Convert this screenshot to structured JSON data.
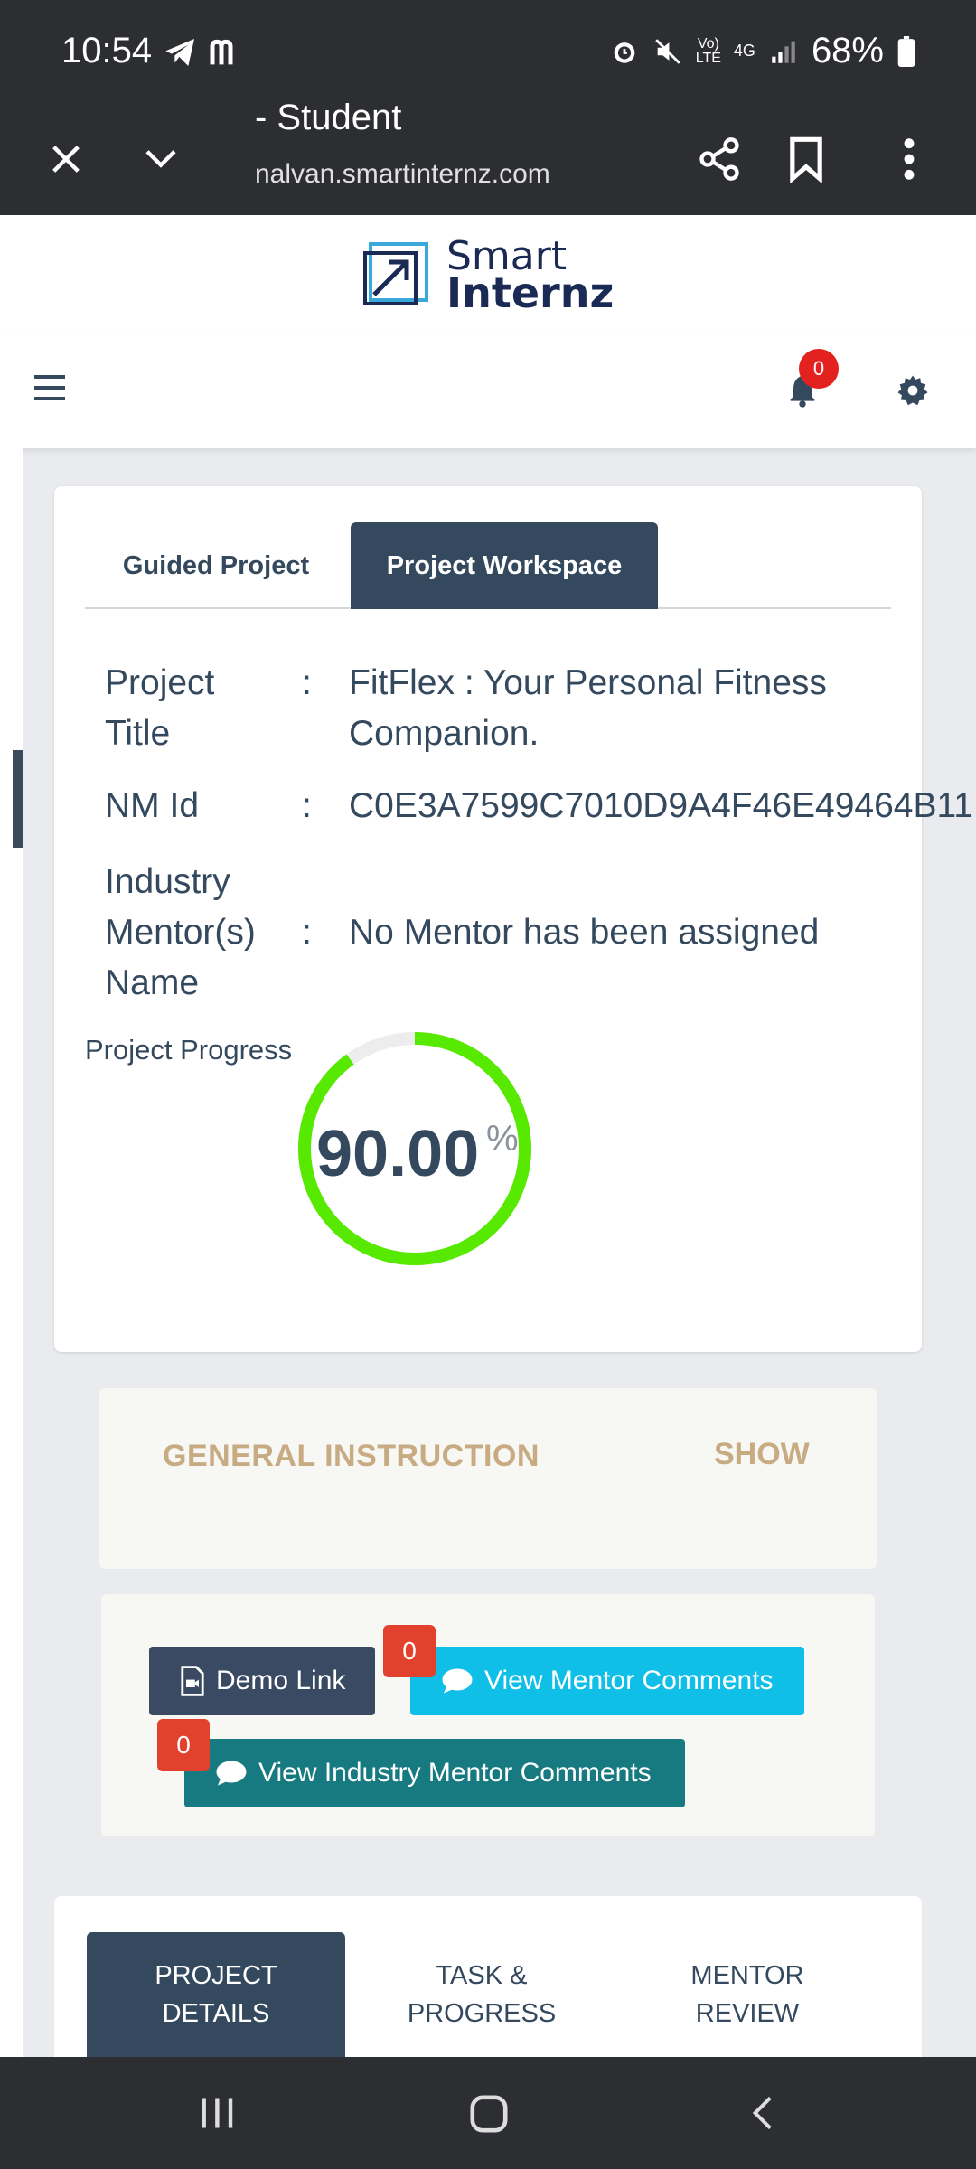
{
  "status_bar": {
    "time": "10:54",
    "battery": "68%",
    "network": "4G"
  },
  "browser": {
    "page_title": "- Student",
    "url": "nalvan.smartinternz.com"
  },
  "site": {
    "logo_line1": "Smart",
    "logo_line2": "Internz",
    "notification_count": "0"
  },
  "project_card": {
    "tabs": [
      {
        "label": "Guided Project",
        "active": false
      },
      {
        "label": "Project Workspace",
        "active": true
      }
    ],
    "rows": [
      {
        "label": "Project Title",
        "colon": ":",
        "value_line1": "FitFlex : Your Personal Fitness",
        "value_line2": "Companion."
      },
      {
        "label": "NM Id",
        "colon": ":",
        "value": "C0E3A7599C7010D9A4F46E49464B11"
      },
      {
        "label": "Industry Mentor(s) Name",
        "colon": ":",
        "value": "No Mentor has been assigned"
      }
    ],
    "progress_label": "Project Progress",
    "progress_value": "90.00",
    "progress_unit": "%",
    "progress_fraction": 0.9,
    "progress_color": "#57e900"
  },
  "instruction": {
    "title": "GENERAL INSTRUCTION",
    "toggle": "SHOW"
  },
  "actions": {
    "demo_link": "Demo Link",
    "view_mentor_comments": "View Mentor Comments",
    "mentor_comments_count": "0",
    "view_industry_mentor_comments": "View Industry Mentor Comments",
    "industry_comments_count": "0"
  },
  "bottom_tabs": [
    {
      "line1": "PROJECT",
      "line2": "DETAILS",
      "active": true
    },
    {
      "line1": "TASK &",
      "line2": "PROGRESS",
      "active": false
    },
    {
      "line1": "MENTOR",
      "line2": "REVIEW",
      "active": false
    }
  ],
  "colors": {
    "primary": "#34495e",
    "accent_cyan": "#0fbfe8",
    "accent_teal": "#167a80",
    "badge_red": "#e2412d",
    "instruction_gold": "#c8ab82"
  }
}
